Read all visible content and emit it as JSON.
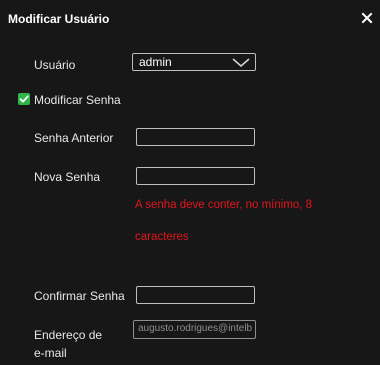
{
  "dialog": {
    "title": "Modificar Usuário",
    "close_icon": "close-icon"
  },
  "user": {
    "label": "Usuário",
    "selected_value": "admin",
    "dropdown_icon": "chevron-down-icon"
  },
  "modify_password": {
    "label": "Modificar Senha",
    "checked": true,
    "check_color": "#2fb54a"
  },
  "old_password": {
    "label": "Senha Anterior",
    "value": ""
  },
  "new_password": {
    "label": "Nova Senha",
    "value": "",
    "error_line1": "A senha deve conter, no mínimo, 8",
    "error_line2": "caracteres",
    "error_color": "#e0161c"
  },
  "confirm_password": {
    "label": "Confirmar Senha",
    "value": ""
  },
  "email": {
    "label_line1": "Endereço de",
    "label_line2": "e-mail",
    "value": "augusto.rodrigues@intelb"
  }
}
